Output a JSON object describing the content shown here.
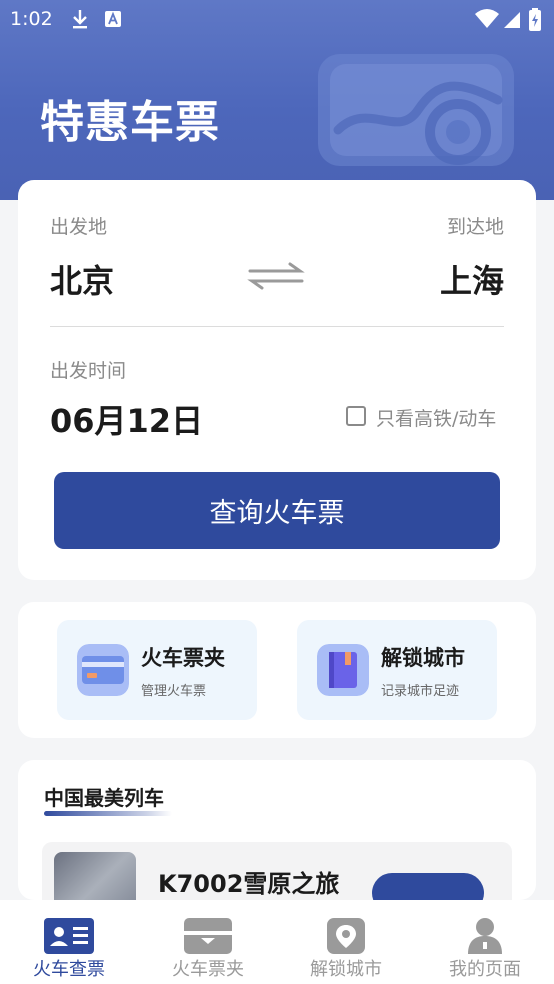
{
  "status_bar": {
    "time": "1:02"
  },
  "header": {
    "title": "特惠车票"
  },
  "search": {
    "from_label": "出发地",
    "to_label": "到达地",
    "from_city": "北京",
    "to_city": "上海",
    "date_label": "出发时间",
    "date_value": "06月12日",
    "high_speed_only_label": "只看高铁/动车",
    "high_speed_only_checked": false,
    "search_button_label": "查询火车票"
  },
  "features": [
    {
      "title": "火车票夹",
      "subtitle": "管理火车票",
      "icon": "ticket-card-icon"
    },
    {
      "title": "解锁城市",
      "subtitle": "记录城市足迹",
      "icon": "city-book-icon"
    }
  ],
  "beauty_trains": {
    "title": "中国最美列车",
    "items": [
      {
        "name": "K7002雪原之旅"
      }
    ]
  },
  "tabs": [
    {
      "label": "火车查票",
      "icon": "id-card-icon",
      "active": true
    },
    {
      "label": "火车票夹",
      "icon": "ticket-wallet-icon",
      "active": false
    },
    {
      "label": "解锁城市",
      "icon": "map-pin-icon",
      "active": false
    },
    {
      "label": "我的页面",
      "icon": "user-icon",
      "active": false
    }
  ],
  "colors": {
    "primary": "#2f4a9d",
    "header": "#4d67bb",
    "feature_bg": "#eef6fd",
    "inactive_tab": "#9a9a9a"
  }
}
